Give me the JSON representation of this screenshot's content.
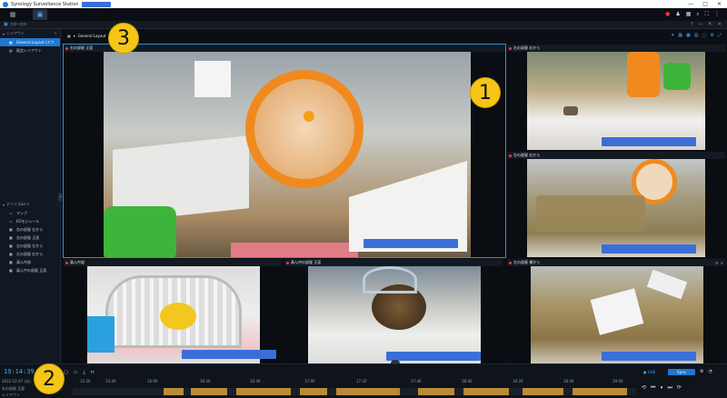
{
  "window": {
    "title": "Synology Surveillance Station",
    "controls": [
      "—",
      "□",
      "✕"
    ]
  },
  "appbar": {
    "icons": [
      "apps-icon",
      "monitor-center-icon"
    ],
    "right_icons": [
      "notification-icon",
      "user-icon",
      "grid-icon",
      "search-icon",
      "fullscreen-icon",
      "more-icon"
    ]
  },
  "subbar": {
    "title": "ﾓﾆﾀｰ･ｾﾝﾀｰ",
    "right": [
      "?",
      "—",
      "⇱",
      "✕"
    ]
  },
  "sidebar": {
    "layout_section": "レイアウト",
    "layouts": [
      {
        "label": "General Layout (デフ",
        "selected": true
      },
      {
        "label": "既定レイアウト",
        "selected": false
      }
    ],
    "device_section": "デバイス&ﾙｰﾙ",
    "devices": [
      {
        "label": "マップ"
      },
      {
        "label": "I/Oモジュール"
      },
      {
        "label": "右の部屋 右から"
      },
      {
        "label": "右の部屋 正面"
      },
      {
        "label": "左の部屋 左から"
      },
      {
        "label": "左の部屋 右から"
      },
      {
        "label": "真ん中部"
      },
      {
        "label": "真ん中の部屋 正面"
      }
    ]
  },
  "main": {
    "layout_name": "General Layout",
    "cameras": [
      {
        "name": "右の部屋 正面"
      },
      {
        "name": "右の部屋 右から"
      },
      {
        "name": "左の部屋 右から"
      },
      {
        "name": "真ん中部"
      },
      {
        "name": "真ん中の部屋 正面"
      },
      {
        "name": "左の部屋 横から"
      }
    ]
  },
  "timeline": {
    "clock": "19:14:39",
    "date": "2022-12-07 (水)",
    "camera": "右の部屋 正面",
    "layout": "レイアウト",
    "ticks": [
      "15:30",
      "15:40",
      "16:00",
      "16:20",
      "16:40",
      "17:00",
      "17:20",
      "17:40",
      "18:00",
      "18:20",
      "18:40",
      "19:00",
      "19:20"
    ],
    "live": "● LIVE",
    "sync": "Sync"
  },
  "callouts": [
    "1",
    "2",
    "3"
  ]
}
